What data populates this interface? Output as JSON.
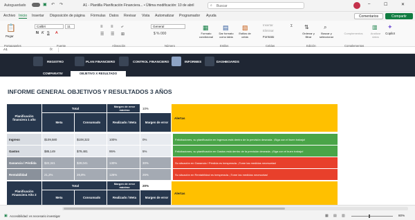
{
  "titlebar": {
    "autosave": "Autoguardado",
    "file_title": "A1 - Plantilla Planificación Financiera... • Última modificación: 10 de abril",
    "search": "Buscar"
  },
  "menu": [
    "Archivo",
    "Inicio",
    "Insertar",
    "Disposición de página",
    "Fórmulas",
    "Datos",
    "Revisar",
    "Vista",
    "Automatizar",
    "Programador",
    "Ayuda"
  ],
  "actions": {
    "comments": "Comentarios",
    "share": "Compartir"
  },
  "ribbon": {
    "paste": "Pegar",
    "font": "Calibri",
    "size": "11",
    "format": "General",
    "cond_format": "Formato condicional",
    "table_format": "Dar formato como tabla",
    "cell_styles": "Estilos de celda",
    "insert": "Insertar",
    "delete": "Eliminar",
    "format_cells": "Formato",
    "sort": "Ordenar y filtrar",
    "find": "Buscar y seleccionar",
    "addins": "Complementos",
    "analyze": "Analizar datos",
    "copilot": "Copilot",
    "groups": [
      "Portapapeles",
      "Fuente",
      "Alineación",
      "Número",
      "Estilos",
      "Celdas",
      "Edición",
      "Complementos"
    ]
  },
  "formula_bar": {
    "cell": "A1",
    "fx": "fx"
  },
  "dashboard": {
    "nav": [
      "REGISTRO",
      "PLAN FINANCIERO",
      "CONTROL FINANCIERO",
      "INFORMES",
      "DASHBOARDS"
    ],
    "tabs": [
      "COMPARATIV",
      "OBJETIVO X RESULTADO"
    ]
  },
  "sheet": {
    "title": "INFORME GENERAL OBJETIVOS Y RESULTADOS 3 AÑOS",
    "t1": {
      "rowhead": "Planificación financiera 1 año",
      "total": "Total",
      "margin_hdr": "Margen de error máximo",
      "margin_val": "10%",
      "alerts": "Alertas",
      "cols": [
        "Meta",
        "Consumado",
        "Realizado / Meta",
        "Margen de error"
      ],
      "rows": [
        {
          "label": "Ingreso",
          "meta": "$109,580",
          "cons": "$108,322",
          "ratio": "100%",
          "err": "0%",
          "alert": "Felicitaciones, su planificación en Ingresos está dentro de la previsión deseada. ¡Siga con el buen trabajo!"
        },
        {
          "label": "Gastos",
          "meta": "$85,149",
          "cons": "$79,481",
          "ratio": "95%",
          "err": "5%",
          "alert": "Felicitaciones, su planificación en Gastos está dentro de la previsión deseada. ¡Siga con el buen trabajo!"
        },
        {
          "label": "Ganancia / Pérdida",
          "meta": "$22,341",
          "cons": "$29,041",
          "ratio": "130%",
          "err": "30%",
          "alert": "Su situación en Ganancia / Pérdida es inesperada. ¡Tome las medidas necesarias!"
        },
        {
          "label": "Rentabilidad",
          "meta": "21,2%",
          "cons": "26,8%",
          "ratio": "126%",
          "err": "26%",
          "alert": "Su situación en Rentabilidad es inesperada. ¡Tome las medidas necesarias!"
        }
      ]
    },
    "t2": {
      "rowhead": "Planificación Financiera Año 2",
      "total": "Total",
      "margin_hdr": "Margen de error máximo",
      "margin_val": "20%",
      "alerts": "Alertas",
      "cols": [
        "Meta",
        "Consumado",
        "Realizado / Meta",
        "Margen de error"
      ]
    }
  },
  "status": {
    "accessibility": "Accesibilidad: es necesario investigar",
    "zoom": "80%"
  },
  "colors": {
    "navy": "#27374d",
    "alert_yellow": "#ffc000",
    "alert_green": "#4aa548",
    "alert_red": "#e8402b",
    "excel_green": "#107c41"
  }
}
